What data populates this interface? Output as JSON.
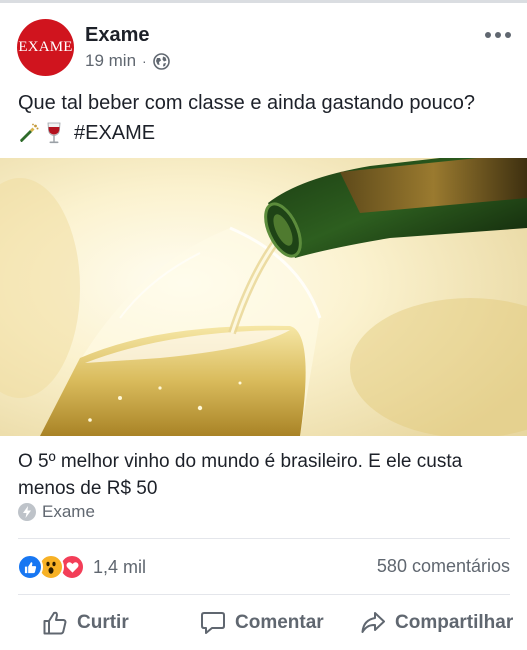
{
  "post": {
    "page_name": "Exame",
    "avatar_text": "EXAME",
    "time": "19 min",
    "separator": "·",
    "privacy_icon": "globe-icon",
    "more_icon": "more-horizontal-icon",
    "text_line1": "Que tal beber com classe e ainda gastando pouco?",
    "hashtag": "#EXAME",
    "emojis": [
      "bottle-with-popping-cork-emoji",
      "wine-glass-emoji"
    ]
  },
  "link": {
    "title": "O 5º melhor vinho do mundo é brasileiro. E ele custa menos de R$ 50",
    "source": "Exame",
    "source_icon": "instant-article-bolt-icon"
  },
  "stats": {
    "reactions": [
      "like",
      "wow",
      "love"
    ],
    "reaction_count": "1,4 mil",
    "comments": "580 comentários"
  },
  "actions": {
    "like": "Curtir",
    "comment": "Comentar",
    "share": "Compartilhar"
  },
  "colors": {
    "brand_red": "#d0141e",
    "like_blue": "#1877f2",
    "wow_yellow": "#f7b125",
    "love_red": "#f33e58",
    "secondary_text": "#606770"
  }
}
